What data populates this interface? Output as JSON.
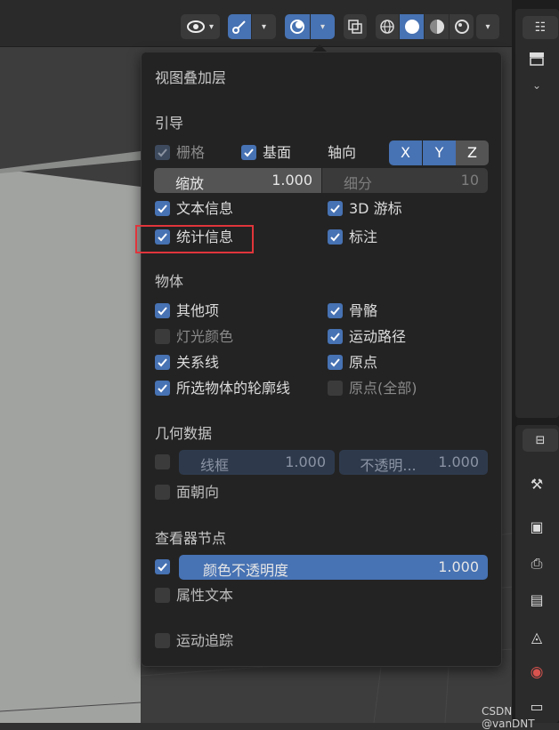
{
  "popup": {
    "title": "视图叠加层",
    "guides": {
      "section": "引导",
      "grid_label": "栅格",
      "floor_label": "基面",
      "axis_label": "轴向",
      "axis_x": "X",
      "axis_y": "Y",
      "axis_z": "Z",
      "scale_label": "缩放",
      "scale_value": "1.000",
      "subdivisions_label": "细分",
      "subdivisions_value": "10",
      "text_info_label": "文本信息",
      "cursor_3d_label": "3D 游标",
      "statistics_label": "统计信息",
      "annotations_label": "标注"
    },
    "objects": {
      "section": "物体",
      "extras_label": "其他项",
      "bones_label": "骨骼",
      "light_colors_label": "灯光颜色",
      "motion_paths_label": "运动路径",
      "relationship_lines_label": "关系线",
      "origins_label": "原点",
      "outline_selected_label": "所选物体的轮廓线",
      "origins_all_label": "原点(全部)"
    },
    "geometry": {
      "section": "几何数据",
      "wireframe_label": "线框",
      "wireframe_value": "1.000",
      "opacity_label": "不透明...",
      "opacity_value": "1.000",
      "face_orientation_label": "面朝向"
    },
    "viewer_node": {
      "section": "查看器节点",
      "color_opacity_label": "颜色不透明度",
      "color_opacity_value": "1.000",
      "attribute_text_label": "属性文本"
    },
    "motion_tracking_label": "运动追踪"
  },
  "watermark": "CSDN @vanDNT",
  "colors": {
    "accent": "#4772b3",
    "highlight": "#e0353b",
    "popup_bg": "#232323"
  }
}
